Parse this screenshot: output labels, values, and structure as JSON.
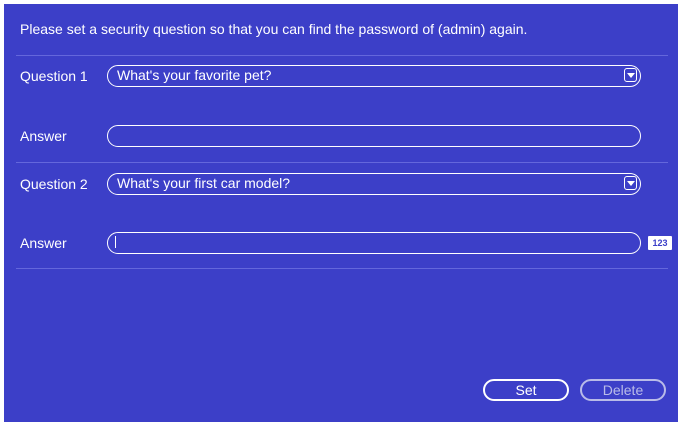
{
  "dialog": {
    "instruction": "Please set a security question so that you can find the password of (admin) again."
  },
  "question1": {
    "label": "Question 1",
    "selected": "What's your favorite pet?"
  },
  "answer1": {
    "label": "Answer",
    "value": ""
  },
  "question2": {
    "label": "Question 2",
    "selected": "What's your first car model?"
  },
  "answer2": {
    "label": "Answer",
    "value": "",
    "input_mode_badge": "123"
  },
  "buttons": {
    "set_label": "Set",
    "delete_label": "Delete"
  },
  "colors": {
    "background": "#3c3fc8",
    "text": "#ffffff",
    "divider": "#6467dc",
    "disabled": "#b9bbe8"
  },
  "icons": {
    "dropdown": "chevron-down-icon"
  }
}
